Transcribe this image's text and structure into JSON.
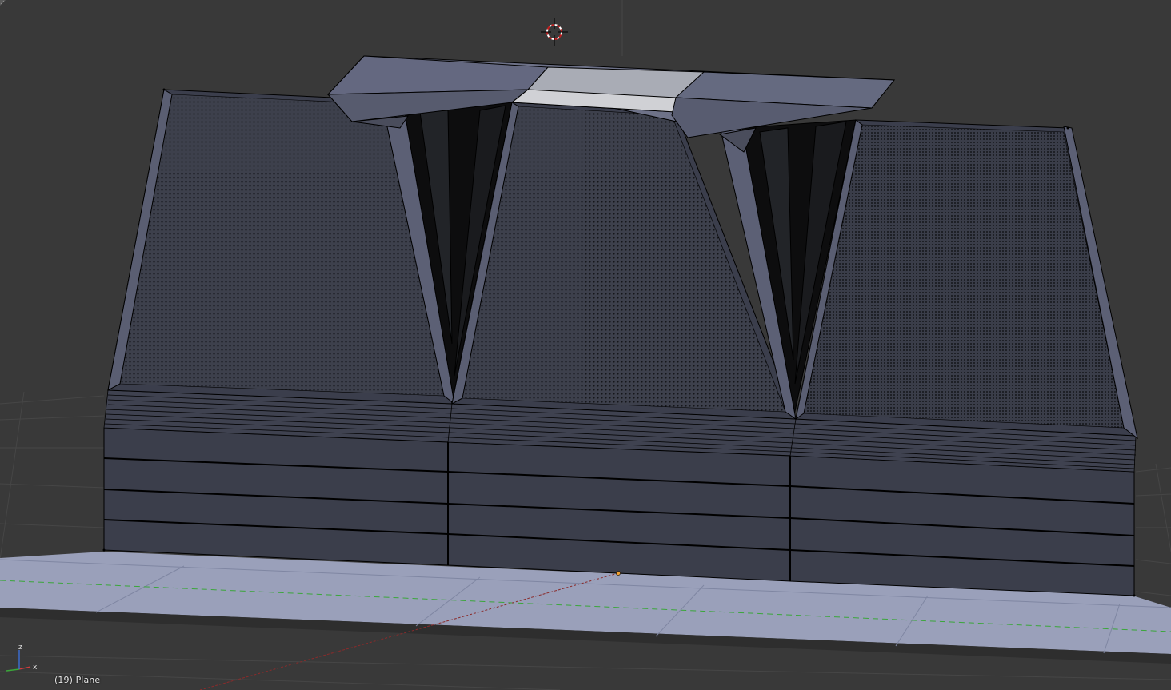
{
  "viewport": {
    "object_label": "(19) Plane",
    "background_color": "#393939",
    "grid_color": "#4a4a4a",
    "mesh_face_color": "#3a3d4a",
    "mesh_edge_color": "#000000",
    "ground_plane_color": "#9ea3bd",
    "x_axis_color": "#c0392b",
    "y_axis_color": "#3aa63a",
    "z_axis_color": "#3b6fd6",
    "icons": {
      "cursor": "3d-cursor-icon",
      "axes": "axis-gizmo-icon",
      "origin": "object-origin-icon"
    }
  }
}
